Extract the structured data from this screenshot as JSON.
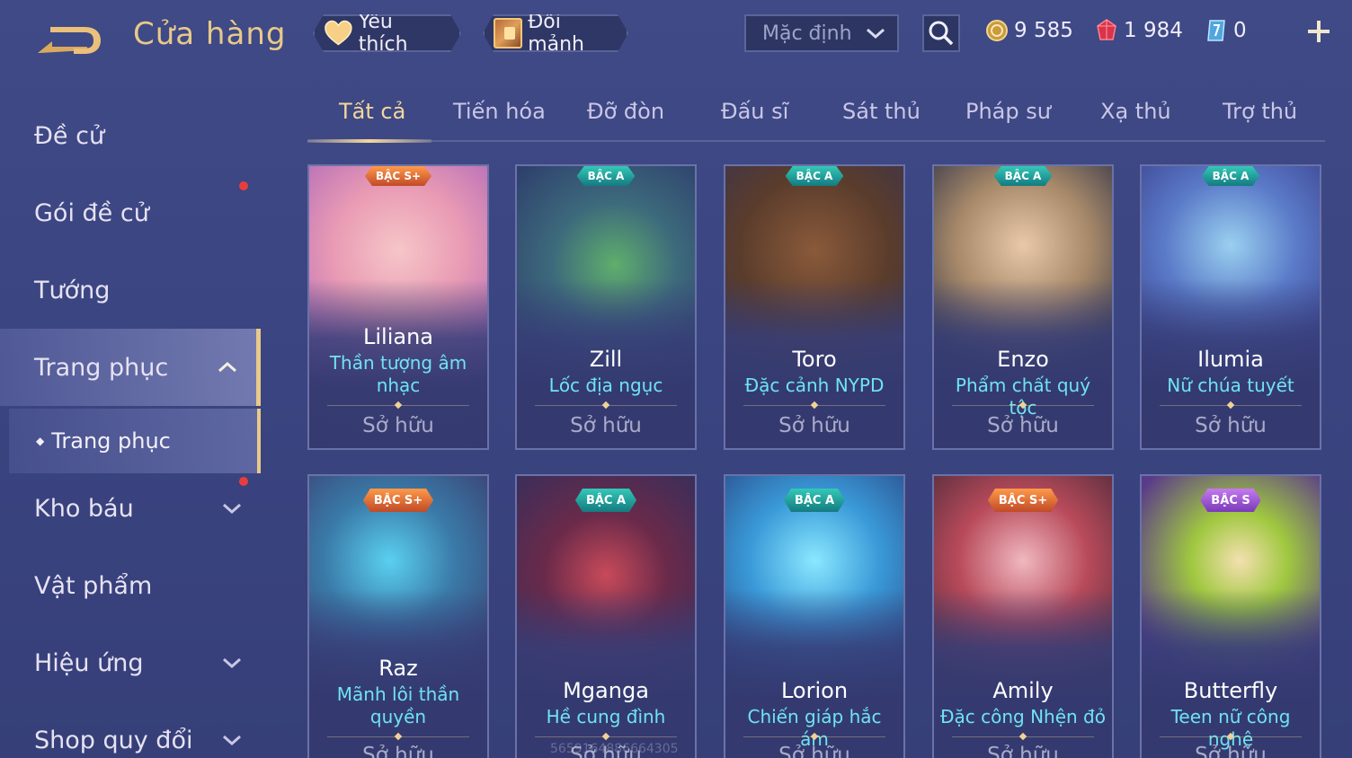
{
  "header": {
    "title": "Cửa hàng",
    "favorite_label": "Yêu thích",
    "exchange_label": "Đổi mảnh",
    "sort_value": "Mặc định",
    "gold": "9 585",
    "vouchers": "1 984",
    "crystals": "0"
  },
  "sidebar": {
    "items": [
      {
        "label": "Đề cử"
      },
      {
        "label": "Gói đề cử"
      },
      {
        "label": "Tướng"
      },
      {
        "label": "Trang phục"
      },
      {
        "label": "Trang phục"
      },
      {
        "label": "Kho báu"
      },
      {
        "label": "Vật phẩm"
      },
      {
        "label": "Hiệu ứng"
      },
      {
        "label": "Shop quy đổi"
      }
    ]
  },
  "tabs": [
    "Tất cả",
    "Tiến hóa",
    "Đỡ đòn",
    "Đấu sĩ",
    "Sát thủ",
    "Pháp sư",
    "Xạ thủ",
    "Trợ thủ"
  ],
  "cards": [
    {
      "rank": "BẬC S+",
      "hero": "Liliana",
      "skin": "Thần tượng âm nhạc",
      "status": "Sở hữu"
    },
    {
      "rank": "BẬC A",
      "hero": "Zill",
      "skin": "Lốc địa ngục",
      "status": "Sở hữu"
    },
    {
      "rank": "BẬC A",
      "hero": "Toro",
      "skin": "Đặc cảnh NYPD",
      "status": "Sở hữu"
    },
    {
      "rank": "BẬC A",
      "hero": "Enzo",
      "skin": "Phẩm chất quý tộc",
      "status": "Sở hữu"
    },
    {
      "rank": "BẬC A",
      "hero": "Ilumia",
      "skin": "Nữ chúa tuyết",
      "status": "Sở hữu"
    },
    {
      "rank": "BẬC S+",
      "hero": "Raz",
      "skin": "Mãnh lôi thần quyền",
      "status": "Sở hữu"
    },
    {
      "rank": "BẬC A",
      "hero": "Mganga",
      "skin": "Hề cung đình",
      "status": "Sở hữu"
    },
    {
      "rank": "BẬC A",
      "hero": "Lorion",
      "skin": "Chiến giáp hắc ám",
      "status": "Sở hữu"
    },
    {
      "rank": "BẬC S+",
      "hero": "Amily",
      "skin": "Đặc công Nhện đỏ",
      "status": "Sở hữu"
    },
    {
      "rank": "BẬC S",
      "hero": "Butterfly",
      "skin": "Teen nữ công nghệ",
      "status": "Sở hữu"
    }
  ],
  "watermark": "5659164886664305",
  "colors": {
    "accent_gold": "#e8c98a",
    "skin_name": "#6fe3f0",
    "background": "#3a4480",
    "badge_red": "#e83d3d"
  }
}
